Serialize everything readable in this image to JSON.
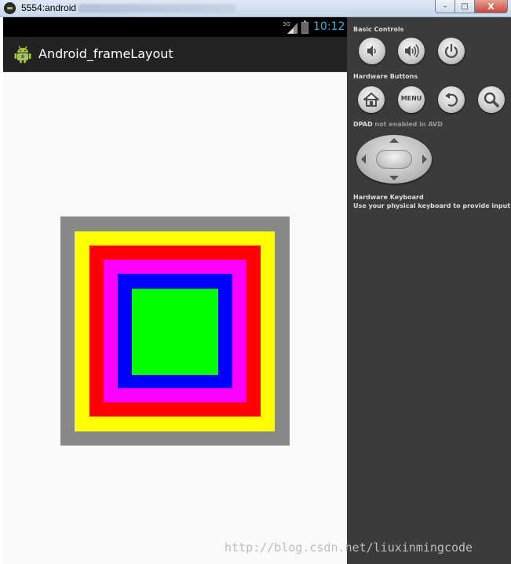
{
  "window": {
    "title": "5554:android",
    "minimize_glyph": "–",
    "maximize_glyph": "□",
    "close_glyph": "X"
  },
  "statusbar": {
    "network_label": "3G",
    "time": "10:12"
  },
  "actionbar": {
    "title": "Android_frameLayout",
    "icon": "android-robot-icon"
  },
  "frame_layers": [
    {
      "name": "gray-layer",
      "color": "#888888"
    },
    {
      "name": "yellow-layer",
      "color": "#ffff00"
    },
    {
      "name": "red-layer",
      "color": "#ff0000"
    },
    {
      "name": "magenta-layer",
      "color": "#ff00ff"
    },
    {
      "name": "blue-layer",
      "color": "#0000ff"
    },
    {
      "name": "green-layer",
      "color": "#00ff00"
    }
  ],
  "controls": {
    "basic_controls_label": "Basic Controls",
    "hardware_buttons_label": "Hardware Buttons",
    "dpad_label": "DPAD",
    "dpad_status": "not enabled in AVD",
    "keyboard_label": "Hardware Keyboard",
    "keyboard_desc": "Use your physical keyboard to provide input",
    "menu_label": "MENU",
    "icons": {
      "volume_down": "volume-down-icon",
      "volume_up": "volume-up-icon",
      "power": "power-icon",
      "home": "home-icon",
      "menu": "menu-icon",
      "back": "back-icon",
      "search": "search-icon"
    }
  },
  "watermark": "http://blog.csdn.net/liuxinmingcode"
}
